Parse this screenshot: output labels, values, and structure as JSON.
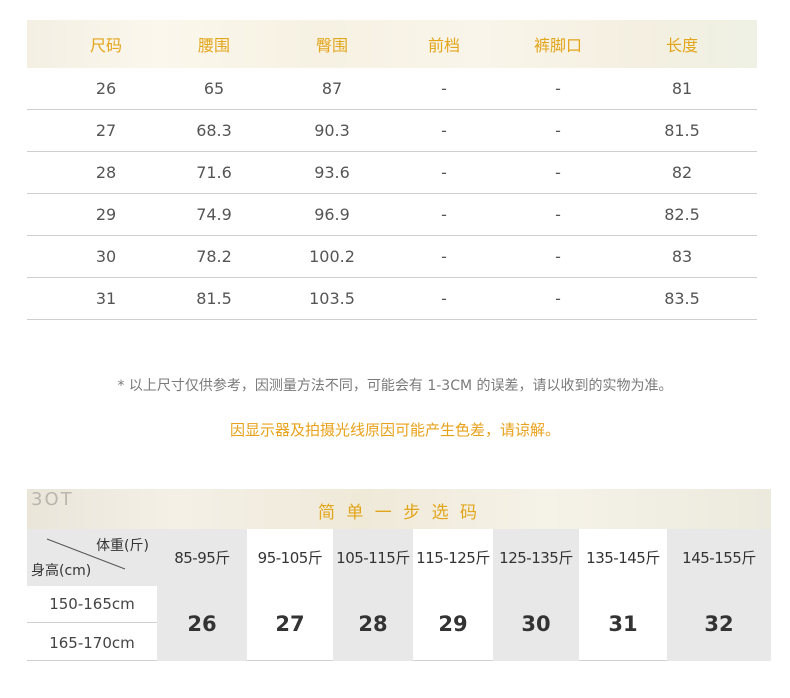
{
  "size_table": {
    "headers": [
      "尺码",
      "腰围",
      "臀围",
      "前档",
      "裤脚口",
      "长度"
    ],
    "rows": [
      [
        "26",
        "65",
        "87",
        "-",
        "-",
        "81"
      ],
      [
        "27",
        "68.3",
        "90.3",
        "-",
        "-",
        "81.5"
      ],
      [
        "28",
        "71.6",
        "93.6",
        "-",
        "-",
        "82"
      ],
      [
        "29",
        "74.9",
        "96.9",
        "-",
        "-",
        "82.5"
      ],
      [
        "30",
        "78.2",
        "100.2",
        "-",
        "-",
        "83"
      ],
      [
        "31",
        "81.5",
        "103.5",
        "-",
        "-",
        "83.5"
      ]
    ]
  },
  "notes": {
    "disclaimer": "* 以上尺寸仅供参考，因测量方法不同，可能会有 1-3CM 的误差，请以收到的实物为准。",
    "color_note": "因显示器及拍摄光线原因可能产生色差，请谅解。"
  },
  "quick_select": {
    "bg_text": "3OT",
    "title": "简 单 一 步 选 码",
    "corner_weight": "体重(斤)",
    "corner_height": "身高(cm)",
    "height_rows": [
      "150-165cm",
      "165-170cm"
    ],
    "weight_ranges": [
      "85-95斤",
      "95-105斤",
      "105-115斤",
      "115-125斤",
      "125-135斤",
      "135-145斤",
      "145-155斤"
    ],
    "sizes": [
      "26",
      "27",
      "28",
      "29",
      "30",
      "31",
      "32"
    ]
  },
  "colors": {
    "accent": "#e3a51a",
    "text": "#555555",
    "shade": "#e8e8e8"
  }
}
